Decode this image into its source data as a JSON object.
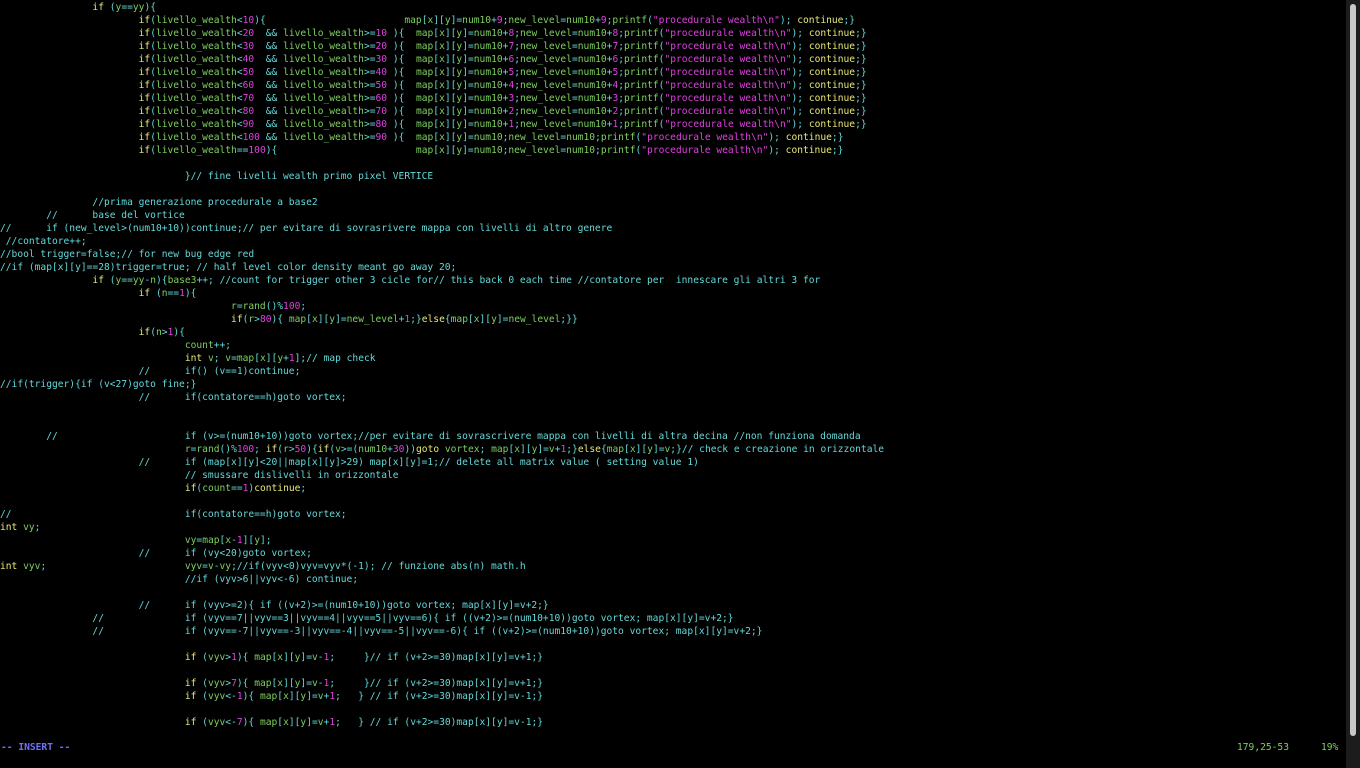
{
  "editor": {
    "lines": [
      "                if (y==yy){",
      "                        if(livello_wealth<10){                        map[x][y]=num10+9;new_level=num10+9;printf(\"procedurale wealth\\n\"); continue;}",
      "                        if(livello_wealth<20  && livello_wealth>=10 ){  map[x][y]=num10+8;new_level=num10+8;printf(\"procedurale wealth\\n\"); continue;}",
      "                        if(livello_wealth<30  && livello_wealth>=20 ){  map[x][y]=num10+7;new_level=num10+7;printf(\"procedurale wealth\\n\"); continue;}",
      "                        if(livello_wealth<40  && livello_wealth>=30 ){  map[x][y]=num10+6;new_level=num10+6;printf(\"procedurale wealth\\n\"); continue;}",
      "                        if(livello_wealth<50  && livello_wealth>=40 ){  map[x][y]=num10+5;new_level=num10+5;printf(\"procedurale wealth\\n\"); continue;}",
      "                        if(livello_wealth<60  && livello_wealth>=50 ){  map[x][y]=num10+4;new_level=num10+4;printf(\"procedurale wealth\\n\"); continue;}",
      "                        if(livello_wealth<70  && livello_wealth>=60 ){  map[x][y]=num10+3;new_level=num10+3;printf(\"procedurale wealth\\n\"); continue;}",
      "                        if(livello_wealth<80  && livello_wealth>=70 ){  map[x][y]=num10+2;new_level=num10+2;printf(\"procedurale wealth\\n\"); continue;}",
      "                        if(livello_wealth<90  && livello_wealth>=80 ){  map[x][y]=num10+1;new_level=num10+1;printf(\"procedurale wealth\\n\"); continue;}",
      "                        if(livello_wealth<100 && livello_wealth>=90 ){  map[x][y]=num10;new_level=num10;printf(\"procedurale wealth\\n\"); continue;}",
      "                        if(livello_wealth==100){                        map[x][y]=num10;new_level=num10;printf(\"procedurale wealth\\n\"); continue;}",
      "",
      "                                }// fine livelli wealth primo pixel VERTICE",
      "",
      "                //prima generazione procedurale a base2",
      "        //      base del vortice",
      "//      if (new_level>(num10+10))continue;// per evitare di sovrasrivere mappa con livelli di altro genere",
      " //contatore++;",
      "//bool trigger=false;// for new bug edge red",
      "//if (map[x][y]==28)trigger=true; // half level color density meant go away 20;",
      "                if (y==yy-n){base3++; //count for trigger other 3 cicle for// this back 0 each time //contatore per  innescare gli altri 3 for",
      "                        if (n==1){",
      "                                        r=rand()%100;",
      "                                        if(r>80){ map[x][y]=new_level+1;}else{map[x][y]=new_level;}}",
      "                        if(n>1){",
      "                                count++;",
      "                                int v; v=map[x][y+1];// map check",
      "                        //      if() (v==1)continue;",
      "//if(trigger){if (v<27)goto fine;}",
      "                        //      if(contatore==h)goto vortex;",
      "",
      "",
      "        //                      if (v>=(num10+10))goto vortex;//per evitare di sovrascrivere mappa con livelli di altra decina //non funziona domanda",
      "                                r=rand()%100; if(r>50){if(v>=(num10+30))goto vortex; map[x][y]=v+1;}else{map[x][y]=v;}// check e creazione in orizzontale",
      "                        //      if (map[x][y]<20||map[x][y]>29) map[x][y]=1;// delete all matrix value ( setting value 1)",
      "                                // smussare dislivelli in orizzontale",
      "                                if(count==1)continue;",
      "",
      "//                              if(contatore==h)goto vortex;",
      "int vy;",
      "                                vy=map[x-1][y];",
      "                        //      if (vy<20)goto vortex;",
      "int vyv;                        vyv=v-vy;//if(vyv<0)vyv=vyv*(-1); // funzione abs(n) math.h",
      "                                //if (vyv>6||vyv<-6) continue;",
      "",
      "                        //      if (vyv>=2){ if ((v+2)>=(num10+10))goto vortex; map[x][y]=v+2;}",
      "                //              if (vyv==7||vyv==3||vyv==4||vyv==5||vyv==6){ if ((v+2)>=(num10+10))goto vortex; map[x][y]=v+2;}",
      "                //              if (vyv==-7||vyv==-3||vyv==-4||vyv==-5||vyv==-6){ if ((v+2)>=(num10+10))goto vortex; map[x][y]=v+2;}",
      "",
      "                                if (vyv>1){ map[x][y]=v-1;     }// if (v+2>=30)map[x][y]=v+1;}",
      "",
      "                                if (vyv>7){ map[x][y]=v-1;     }// if (v+2>=30)map[x][y]=v+1;}",
      "                                if (vyv<-1){ map[x][y]=v+1;   } // if (v+2>=30)map[x][y]=v-1;}",
      "",
      "                                if (vyv<-7){ map[x][y]=v+1;   } // if (v+2>=30)map[x][y]=v-1;}"
    ]
  },
  "statusbar": {
    "mode": "-- INSERT --",
    "cursor_position": "179,25-53",
    "scroll_percent": "19%"
  },
  "colors": {
    "background": "#000000",
    "comment": "#63d8d8",
    "keyword": "#e8e878",
    "identifier": "#7ed060",
    "number": "#e040e0",
    "mode": "#7070ff"
  }
}
